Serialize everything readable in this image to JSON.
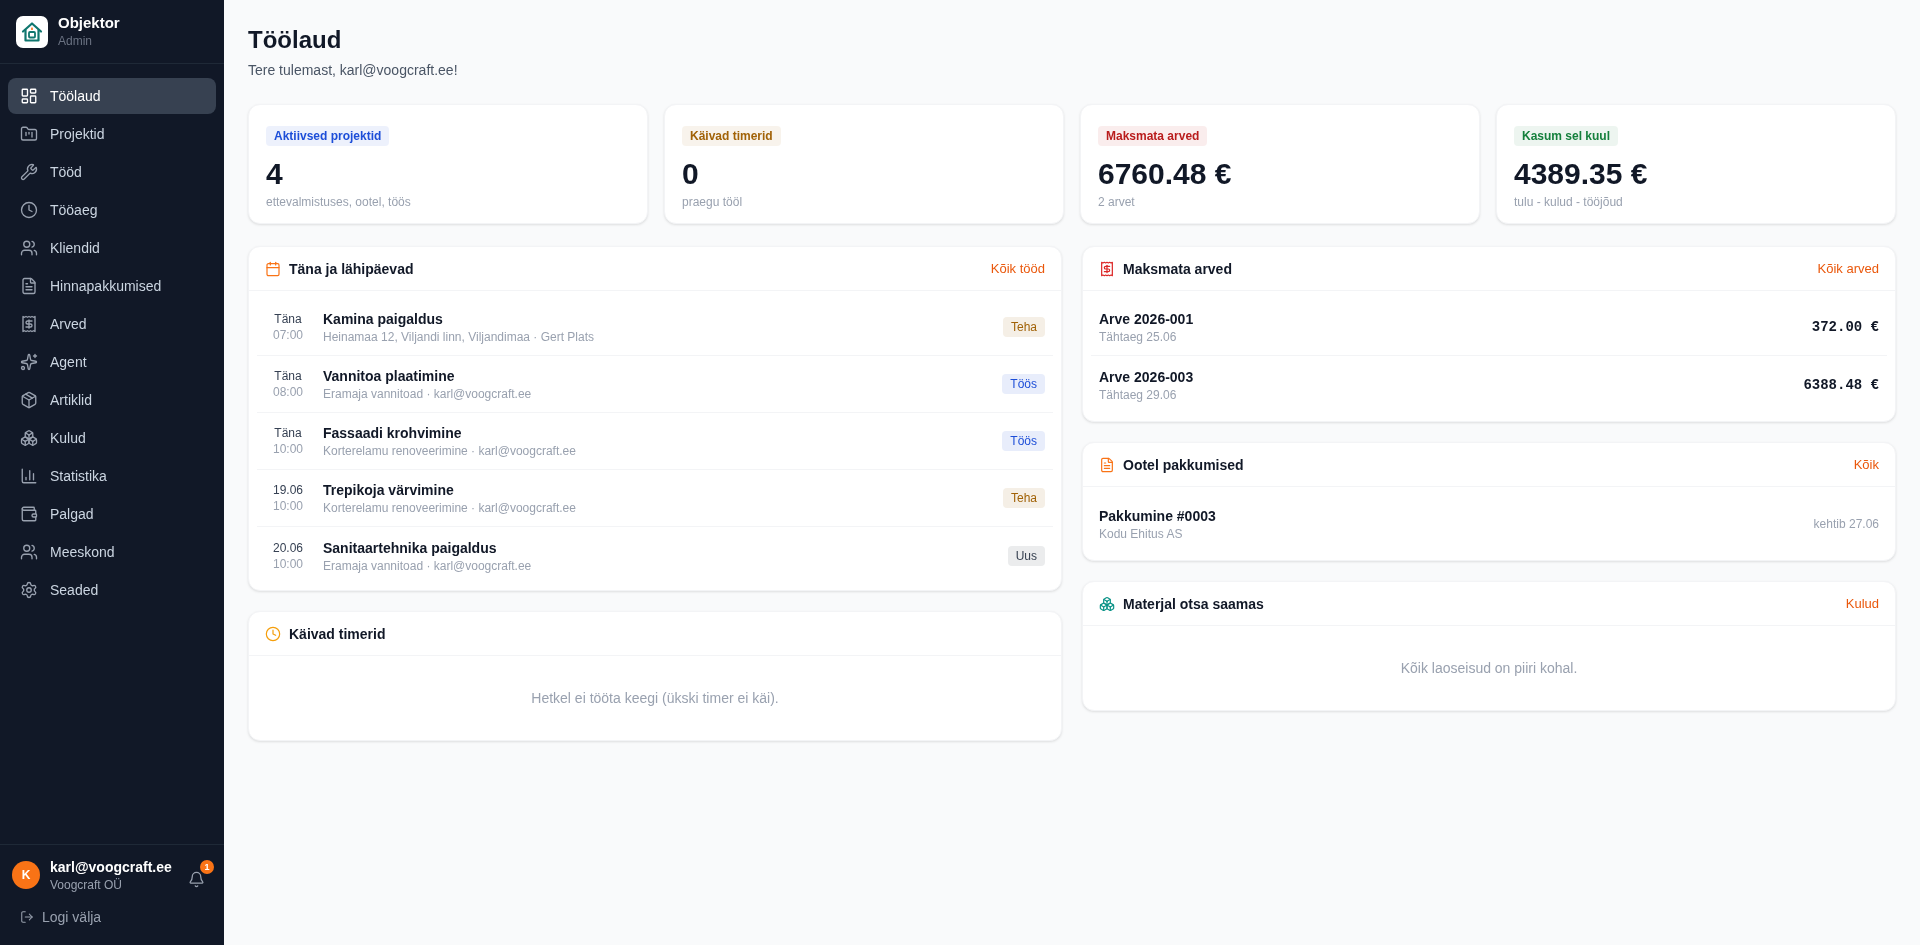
{
  "sidebar": {
    "brand": {
      "name": "Objektor",
      "role": "Admin"
    },
    "items": [
      {
        "label": "Töölaud",
        "selected": true
      },
      {
        "label": "Projektid",
        "selected": false
      },
      {
        "label": "Tööd",
        "selected": false
      },
      {
        "label": "Tööaeg",
        "selected": false
      },
      {
        "label": "Kliendid",
        "selected": false
      },
      {
        "label": "Hinnapakkumised",
        "selected": false
      },
      {
        "label": "Arved",
        "selected": false
      },
      {
        "label": "Agent",
        "selected": false
      },
      {
        "label": "Artiklid",
        "selected": false
      },
      {
        "label": "Kulud",
        "selected": false
      },
      {
        "label": "Statistika",
        "selected": false
      },
      {
        "label": "Palgad",
        "selected": false
      },
      {
        "label": "Meeskond",
        "selected": false
      },
      {
        "label": "Seaded",
        "selected": false
      }
    ],
    "user": {
      "initial": "K",
      "email": "karl@voogcraft.ee",
      "company": "Voogcraft OÜ",
      "notifications": "1"
    },
    "logout": "Logi välja"
  },
  "page": {
    "title": "Töölaud",
    "subtitle": "Tere tulemast, karl@voogcraft.ee!"
  },
  "stats": [
    {
      "label": "Aktiivsed projektid",
      "color": "#1d4ed8",
      "value": "4",
      "note": "ettevalmistuses, ootel, töös"
    },
    {
      "label": "Käivad timerid",
      "color": "#a16207",
      "value": "0",
      "note": "praegu tööl"
    },
    {
      "label": "Maksmata arved",
      "color": "#b91c1c",
      "value": "6760.48 €",
      "note": "2 arvet"
    },
    {
      "label": "Kasum sel kuul",
      "color": "#15803d",
      "value": "4389.35 €",
      "note": "tulu - kulud - tööjõud"
    }
  ],
  "upcoming": {
    "title": "Täna ja lähipäevad",
    "link": "Kõik tööd",
    "items": [
      {
        "day": "Täna",
        "time": "07:00",
        "title": "Kamina paigaldus",
        "details": "Heinamaa 12, Viljandi linn, Viljandimaa · Gert Plats",
        "status": "Teha",
        "color": "#a16207"
      },
      {
        "day": "Täna",
        "time": "08:00",
        "title": "Vannitoa plaatimine",
        "details": "Eramaja vannitoad · karl@voogcraft.ee",
        "status": "Töös",
        "color": "#1d4ed8"
      },
      {
        "day": "Täna",
        "time": "10:00",
        "title": "Fassaadi krohvimine",
        "details": "Korterelamu renoveerimine · karl@voogcraft.ee",
        "status": "Töös",
        "color": "#1d4ed8"
      },
      {
        "day": "19.06",
        "time": "10:00",
        "title": "Trepikoja värvimine",
        "details": "Korterelamu renoveerimine · karl@voogcraft.ee",
        "status": "Teha",
        "color": "#a16207"
      },
      {
        "day": "20.06",
        "time": "10:00",
        "title": "Sanitaartehnika paigaldus",
        "details": "Eramaja vannitoad · karl@voogcraft.ee",
        "status": "Uus",
        "color": "#374151"
      }
    ]
  },
  "timers": {
    "title": "Käivad timerid",
    "empty": "Hetkel ei tööta keegi (ükski timer ei käi)."
  },
  "unpaid_invoices": {
    "title": "Maksmata arved",
    "link": "Kõik arved",
    "items": [
      {
        "number": "Arve 2026-001",
        "due": "Tähtaeg 25.06",
        "amount": "372.00 €"
      },
      {
        "number": "Arve 2026-003",
        "due": "Tähtaeg 29.06",
        "amount": "6388.48 €"
      }
    ]
  },
  "pending_offers": {
    "title": "Ootel pakkumised",
    "link": "Kõik",
    "items": [
      {
        "number": "Pakkumine #0003",
        "client": "Kodu Ehitus AS",
        "valid": "kehtib 27.06"
      }
    ]
  },
  "low_stock": {
    "title": "Materjal otsa saamas",
    "link": "Kulud",
    "empty": "Kõik laoseisud on piiri kohal."
  }
}
